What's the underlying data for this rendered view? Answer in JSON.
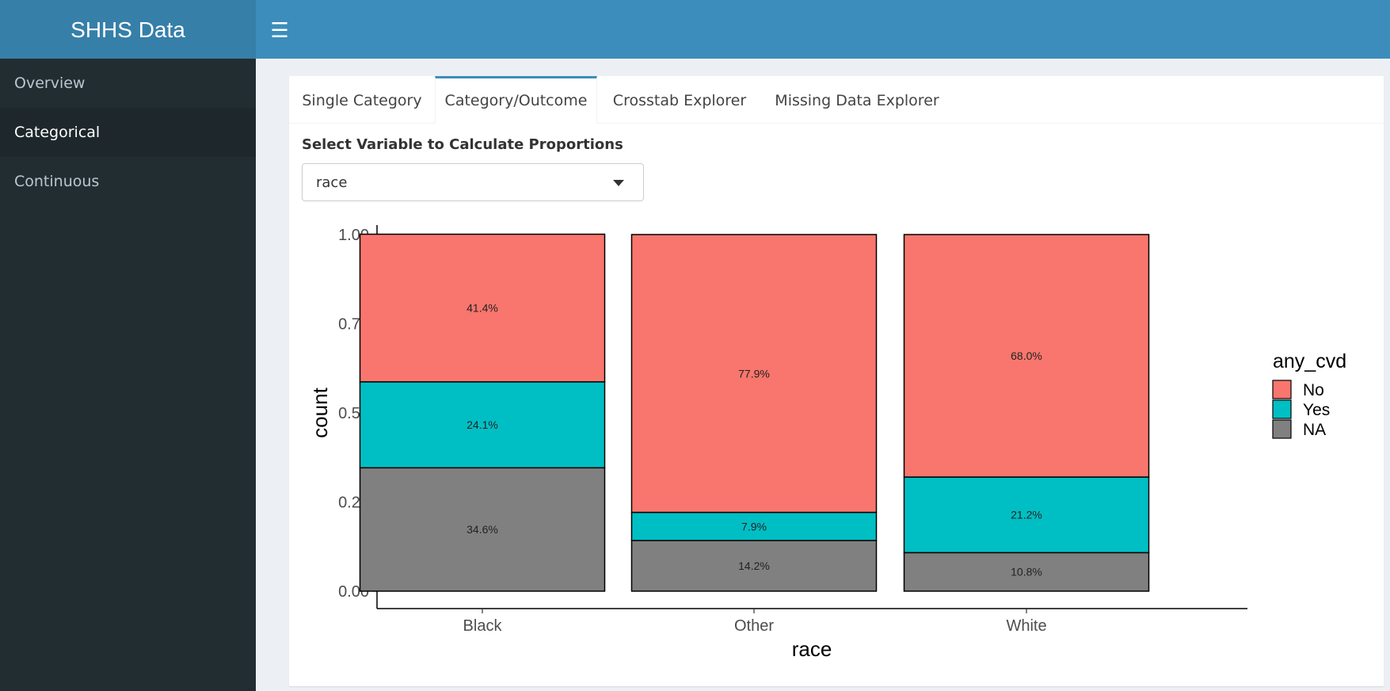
{
  "header": {
    "title": "SHHS Data",
    "menu_icon": "hamburger-icon"
  },
  "sidebar": {
    "items": [
      {
        "label": "Overview",
        "active": false
      },
      {
        "label": "Categorical",
        "active": true
      },
      {
        "label": "Continuous",
        "active": false
      }
    ]
  },
  "tabs": [
    {
      "label": "Single Category",
      "active": false
    },
    {
      "label": "Category/Outcome",
      "active": true
    },
    {
      "label": "Crosstab Explorer",
      "active": false
    },
    {
      "label": "Missing Data Explorer",
      "active": false
    }
  ],
  "form": {
    "select_label": "Select Variable to Calculate Proportions",
    "select_value": "race"
  },
  "colors": {
    "header": "#3c8dbc",
    "sidebar": "#222d32",
    "No": "#f8766d",
    "Yes": "#00bfc4",
    "NA": "#808080"
  },
  "chart_data": {
    "type": "bar",
    "stacked": true,
    "xlabel": "race",
    "ylabel": "count",
    "ylim": [
      0,
      1
    ],
    "yticks": [
      "0.00",
      "0.25",
      "0.50",
      "0.75",
      "1.00"
    ],
    "categories": [
      "Black",
      "Other",
      "White"
    ],
    "legend_title": "any_cvd",
    "legend_position": "right",
    "series": [
      {
        "name": "NA",
        "values": [
          0.346,
          0.142,
          0.108
        ],
        "labels": [
          "34.6%",
          "14.2%",
          "10.8%"
        ],
        "color": "#808080"
      },
      {
        "name": "Yes",
        "values": [
          0.241,
          0.079,
          0.212
        ],
        "labels": [
          "24.1%",
          "7.9%",
          "21.2%"
        ],
        "color": "#00bfc4"
      },
      {
        "name": "No",
        "values": [
          0.414,
          0.779,
          0.68
        ],
        "labels": [
          "41.4%",
          "77.9%",
          "68.0%"
        ],
        "color": "#f8766d"
      }
    ],
    "legend_order": [
      "No",
      "Yes",
      "NA"
    ]
  }
}
